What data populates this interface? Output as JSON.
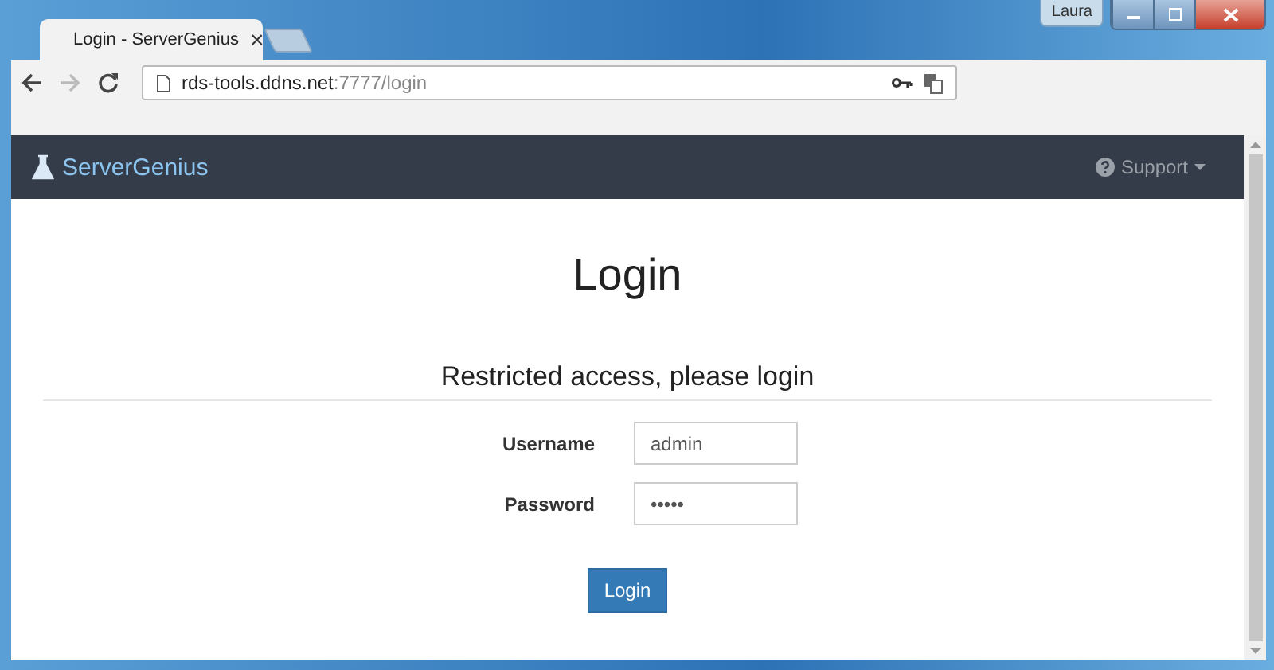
{
  "window": {
    "user_button": "Laura"
  },
  "tabs": [
    {
      "title": "Login - ServerGenius",
      "close": "×",
      "selected": true
    }
  ],
  "address_bar": {
    "host": "rds-tools.ddns.net",
    "path": ":7777/login"
  },
  "navbar": {
    "brand": "ServerGenius",
    "menu": "Support"
  },
  "page": {
    "heading": "Login",
    "subheading": "Restricted access, please login",
    "fields": [
      {
        "label": "Username",
        "value": "admin"
      },
      {
        "label": "Password",
        "value": "•••••"
      }
    ],
    "submit": "Login"
  }
}
